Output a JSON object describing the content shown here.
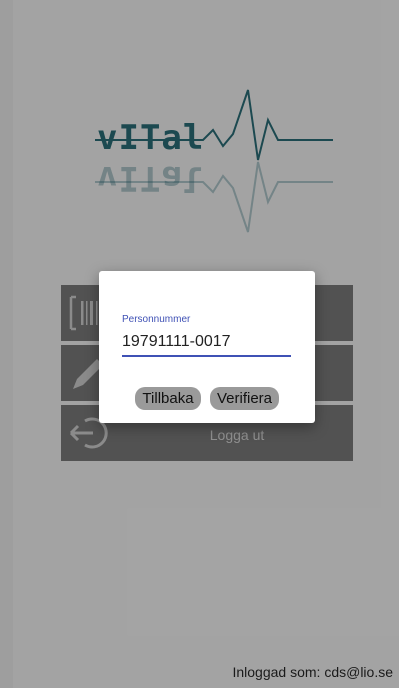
{
  "logo": {
    "text": "vITal"
  },
  "menu": {
    "items": [
      {
        "label": "",
        "icon": "barcode-icon"
      },
      {
        "label": "",
        "icon": "pencil-icon"
      },
      {
        "label": "Logga ut",
        "icon": "logout-icon"
      }
    ]
  },
  "dialog": {
    "field_label": "Personnummer",
    "field_value": "19791111-0017",
    "back_label": "Tillbaka",
    "verify_label": "Verifiera"
  },
  "footer": {
    "text": "Inloggad som: cds@lio.se"
  },
  "colors": {
    "accent": "#3f51b5",
    "logo": "#2b6e78",
    "menu_bg": "#7b7b7b"
  }
}
